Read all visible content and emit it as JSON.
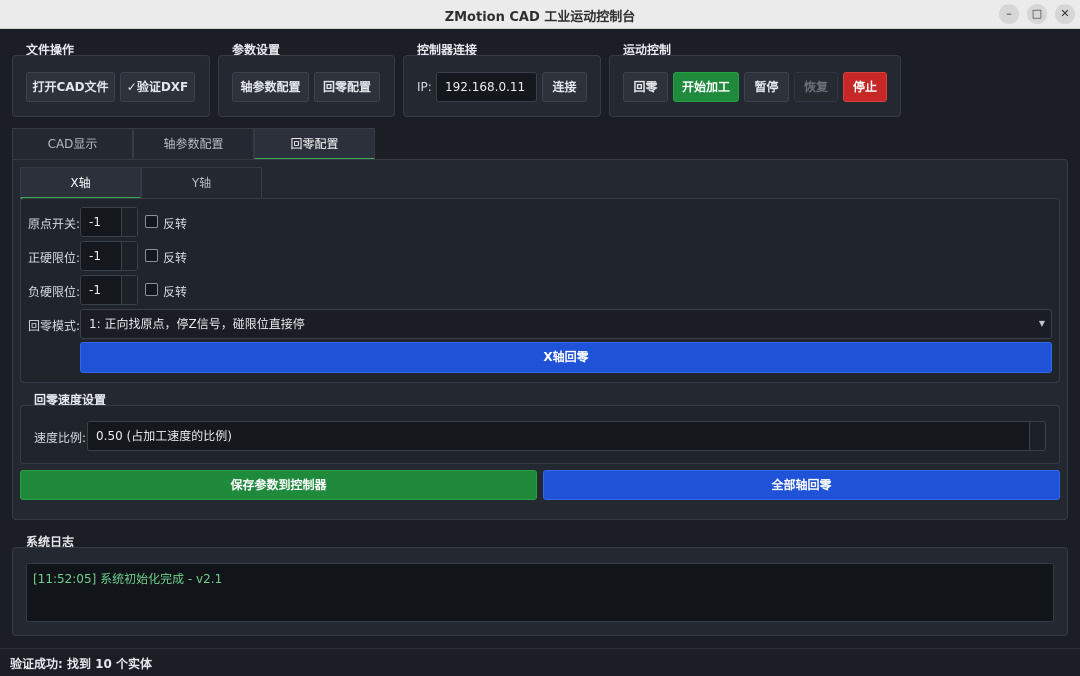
{
  "window": {
    "title": "ZMotion CAD 工业运动控制台"
  },
  "file_ops": {
    "title": "文件操作",
    "open_cad": "打开CAD文件",
    "verify_dxf": "✓验证DXF"
  },
  "params": {
    "title": "参数设置",
    "axis_config": "轴参数配置",
    "home_config": "回零配置"
  },
  "controller": {
    "title": "控制器连接",
    "ip_label": "IP:",
    "ip_value": "192.168.0.11",
    "connect": "连接"
  },
  "motion": {
    "title": "运动控制",
    "home": "回零",
    "start": "开始加工",
    "pause": "暂停",
    "resume": "恢复",
    "stop": "停止"
  },
  "main_tabs": [
    "CAD显示",
    "轴参数配置",
    "回零配置"
  ],
  "axis_tabs": [
    "X轴",
    "Y轴"
  ],
  "home_form": {
    "origin_switch": {
      "label": "原点开关:",
      "value": "-1",
      "invert": "反转"
    },
    "pos_limit": {
      "label": "正硬限位:",
      "value": "-1",
      "invert": "反转"
    },
    "neg_limit": {
      "label": "负硬限位:",
      "value": "-1",
      "invert": "反转"
    },
    "mode_label": "回零模式:",
    "mode_value": "1: 正向找原点，停Z信号，碰限位直接停",
    "axis_home_button": "X轴回零"
  },
  "speed": {
    "title": "回零速度设置",
    "label": "速度比例:",
    "value": "0.50 (占加工速度的比例)"
  },
  "actions": {
    "save": "保存参数到控制器",
    "home_all": "全部轴回零"
  },
  "log": {
    "title": "系统日志",
    "lines": [
      "[11:52:05] 系统初始化完成 - v2.1"
    ]
  },
  "status": {
    "text": "验证成功: 找到 10 个实体"
  },
  "colors": {
    "accent_green": "#1f8a3c",
    "accent_blue": "#1f52d6",
    "danger_red": "#c62828"
  }
}
